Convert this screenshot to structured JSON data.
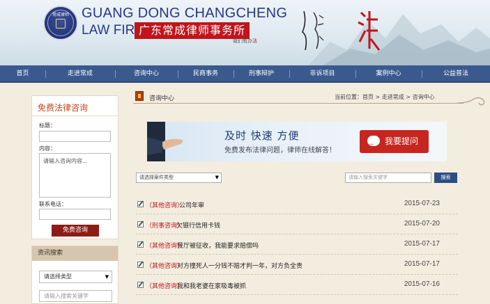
{
  "header": {
    "brand_en_line1": "GUANG DONG CHANGCHENG",
    "brand_en_line2": "LAW FIRM",
    "brand_cn": "广东常成律师事务所",
    "slogan_prefix": "我们有办",
    "slogan_emph": "法",
    "logo_text": "常成律师"
  },
  "nav": {
    "items": [
      {
        "label": "首页",
        "w": 65
      },
      {
        "label": "走进常成",
        "w": 100
      },
      {
        "label": "咨询中心",
        "w": 90
      },
      {
        "label": "民商事务",
        "w": 80
      },
      {
        "label": "刑事辩护",
        "w": 80
      },
      {
        "label": "非诉项目",
        "w": 95
      },
      {
        "label": "案例中心",
        "w": 95
      },
      {
        "label": "公益普法",
        "w": 98
      }
    ]
  },
  "consult_form": {
    "title": "免费法律咨询",
    "title_label": "标题：",
    "content_label": "内容：",
    "content_placeholder": "请输入咨询内容...",
    "phone_label": "联系电话：",
    "submit_label": "免费咨询"
  },
  "info_search": {
    "title": "资讯搜索",
    "type_select": "请选择类型",
    "keyword_placeholder": "请输入搜索关键字"
  },
  "main": {
    "title": "咨询中心",
    "breadcrumb": "当前位置：首页 > 走进常成 > 咨询中心",
    "banner": {
      "headline": "及时  快速  方便",
      "subline": "免费发布法律问题，律师在线解答！",
      "ask_button": "我要提问"
    },
    "case_type_select": "请选择案件类型",
    "keyword_placeholder": "请输入搜索关键字",
    "search_button": "搜索",
    "list": [
      {
        "category": "（其他咨询）",
        "title": "公司年审",
        "date": "2015-07-23"
      },
      {
        "category": "（刑事咨询）",
        "title": "欠银行信用卡钱",
        "date": "2015-07-20"
      },
      {
        "category": "（其他咨询）",
        "title": "餐厅被征收，我能要求赔偿吗",
        "date": "2015-07-17"
      },
      {
        "category": "（其他咨询）",
        "title": "对方撞死人一分钱不赔才判一年，对方负全责",
        "date": "2015-07-17"
      },
      {
        "category": "（其他咨询）",
        "title": "我和我老婆在家吸毒被抓",
        "date": "2015-07-16"
      }
    ]
  },
  "colors": {
    "nav_bg": "#3a5a8e",
    "brand_blue": "#27378a",
    "brand_red": "#c1141b",
    "accent_orange": "#c8411e",
    "submit_bg": "#8c1c16"
  }
}
